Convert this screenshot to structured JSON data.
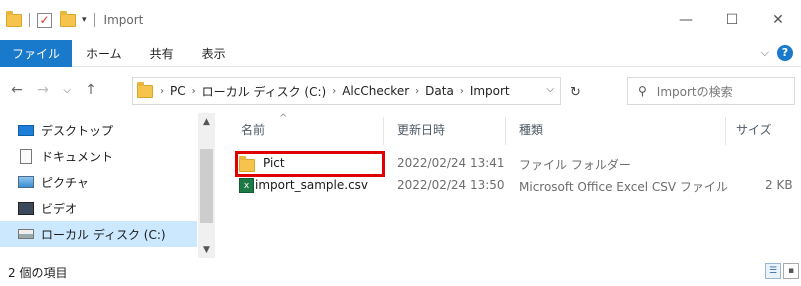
{
  "window": {
    "title": "Import",
    "controls": {
      "minimize": "—",
      "maximize": "☐",
      "close": "✕"
    }
  },
  "ribbon": {
    "file_tab": "ファイル",
    "tabs": [
      "ホーム",
      "共有",
      "表示"
    ],
    "help": "?"
  },
  "address": {
    "breadcrumbs": [
      "PC",
      "ローカル ディスク (C:)",
      "AlcChecker",
      "Data",
      "Import"
    ],
    "search_placeholder": "Importの検索"
  },
  "navpane": {
    "items": [
      {
        "label": "デスクトップ",
        "icon": "desktop-icon"
      },
      {
        "label": "ドキュメント",
        "icon": "document-icon"
      },
      {
        "label": "ピクチャ",
        "icon": "pictures-icon"
      },
      {
        "label": "ビデオ",
        "icon": "video-icon"
      },
      {
        "label": "ローカル ディスク (C:)",
        "icon": "drive-icon",
        "selected": true
      }
    ]
  },
  "list": {
    "columns": [
      "名前",
      "更新日時",
      "種類",
      "サイズ"
    ],
    "rows": [
      {
        "name": "Pict",
        "modified": "2022/02/24 13:41",
        "type": "ファイル フォルダー",
        "size": "",
        "icon": "folder-icon"
      },
      {
        "name": "import_sample.csv",
        "modified": "2022/02/24 13:50",
        "type": "Microsoft Office Excel CSV ファイル",
        "size": "2 KB",
        "icon": "excel-csv-icon"
      }
    ]
  },
  "status": {
    "item_count": "2 個の項目"
  },
  "colors": {
    "accent": "#1979ca",
    "highlight_box": "#e00000",
    "selected_bg": "#cce8ff"
  }
}
